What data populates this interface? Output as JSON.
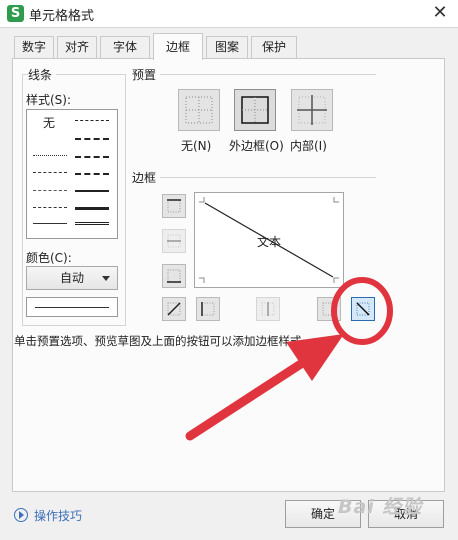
{
  "window": {
    "app_icon_letter": "S",
    "title": "单元格格式",
    "close_glyph": "✕"
  },
  "tabs": [
    {
      "label": "数字"
    },
    {
      "label": "对齐"
    },
    {
      "label": "字体"
    },
    {
      "label": "边框",
      "active": true
    },
    {
      "label": "图案"
    },
    {
      "label": "保护"
    }
  ],
  "line_group": {
    "title": "线条",
    "style_label": "样式(S):",
    "none_label": "无",
    "color_label": "颜色(C):",
    "color_value": "自动"
  },
  "presets": {
    "title": "预置",
    "items": [
      {
        "label": "无(N)"
      },
      {
        "label": "外边框(O)"
      },
      {
        "label": "内部(I)"
      }
    ]
  },
  "border_group": {
    "title": "边框",
    "preview_text": "文本"
  },
  "hint": "单击预置选项、预览草图及上面的按钮可以添加边框样式",
  "footer": {
    "tips_label": "操作技巧",
    "ok_label": "确定",
    "cancel_label": "取消"
  },
  "watermark": "Bai 经验",
  "colors": {
    "annotation_red": "#e0353f",
    "accent_blue": "#2b6cb0",
    "tips_blue": "#3d6fb8"
  }
}
